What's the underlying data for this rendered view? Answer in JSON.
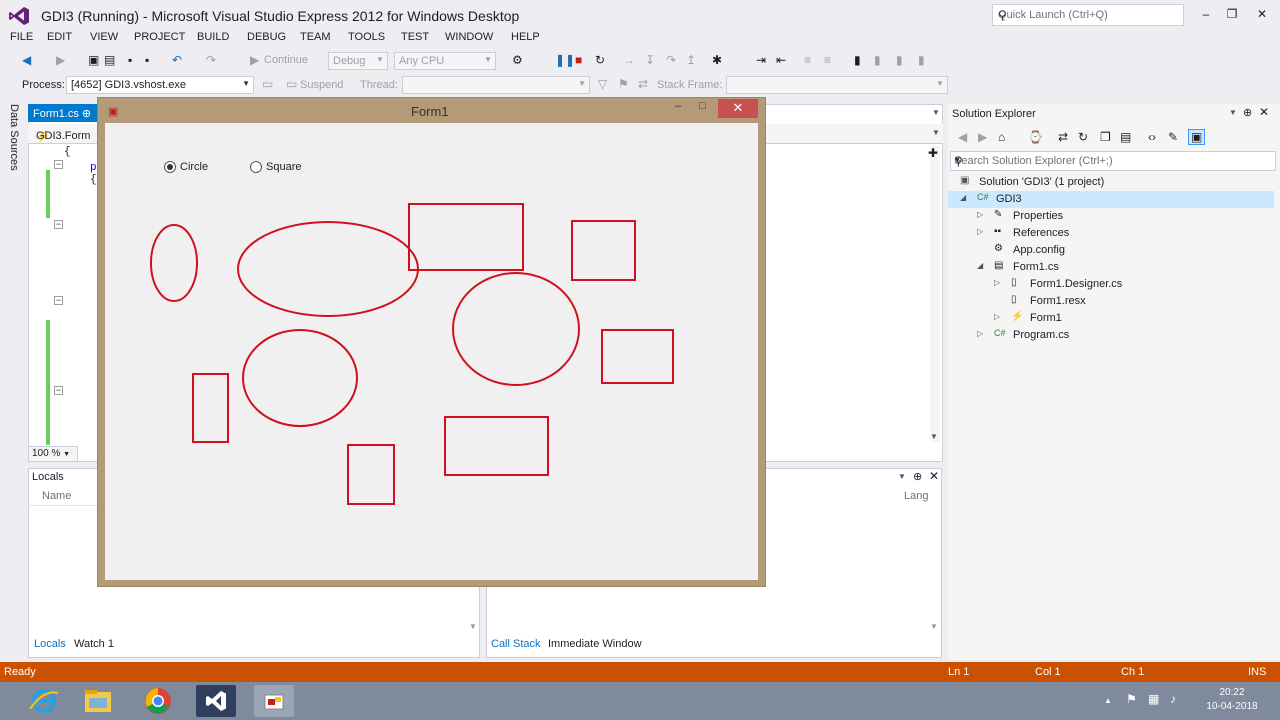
{
  "window": {
    "title": "GDI3 (Running) - Microsoft Visual Studio Express 2012 for Windows Desktop",
    "quick_launch_placeholder": "Quick Launch (Ctrl+Q)",
    "min": "–",
    "restore": "❐",
    "close": "✕"
  },
  "menu": [
    "FILE",
    "EDIT",
    "VIEW",
    "PROJECT",
    "BUILD",
    "DEBUG",
    "TEAM",
    "TOOLS",
    "TEST",
    "WINDOW",
    "HELP"
  ],
  "toolbar": {
    "continue_label": "Continue",
    "config": "Debug",
    "platform": "Any CPU",
    "process_label": "Process:",
    "process_value": "[4652] GDI3.vshost.exe",
    "suspend_label": "Suspend",
    "thread_label": "Thread:",
    "stack_frame_label": "Stack Frame:"
  },
  "left_strip": {
    "data_sources": "Data Sources"
  },
  "editor": {
    "tab_label": "Form1.cs",
    "nav_text": "GDI3.Form",
    "code_brace": "{",
    "code_p": "p",
    "code_brace2": "{",
    "zoom": "100 %"
  },
  "locals": {
    "title": "Locals",
    "col_name": "Name",
    "col_lang": "Lang"
  },
  "bottom_tabs": {
    "locals": "Locals",
    "watch": "Watch 1",
    "call_stack": "Call Stack",
    "immediate": "Immediate Window"
  },
  "solution_explorer": {
    "title": "Solution Explorer",
    "search_placeholder": "Search Solution Explorer (Ctrl+;)",
    "items": [
      {
        "label": "Solution 'GDI3' (1 project)"
      },
      {
        "label": "GDI3"
      },
      {
        "label": "Properties"
      },
      {
        "label": "References"
      },
      {
        "label": "App.config"
      },
      {
        "label": "Form1.cs"
      },
      {
        "label": "Form1.Designer.cs"
      },
      {
        "label": "Form1.resx"
      },
      {
        "label": "Form1"
      },
      {
        "label": "Program.cs"
      }
    ]
  },
  "form1": {
    "title": "Form1",
    "radio_circle": "Circle",
    "radio_square": "Square",
    "selected": "Circle",
    "shape_color": "#D0101E"
  },
  "status": {
    "ready": "Ready",
    "ln": "Ln 1",
    "col": "Col 1",
    "ch": "Ch 1",
    "ins": "INS"
  },
  "taskbar": {
    "time": "20:22",
    "date": "10-04-2018"
  }
}
